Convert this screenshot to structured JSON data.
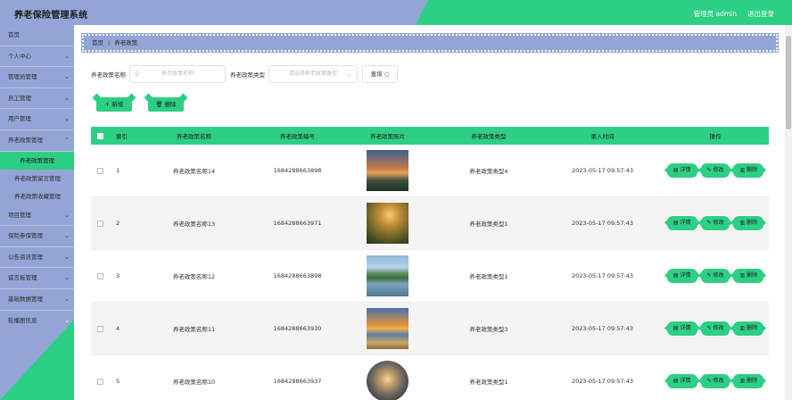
{
  "header": {
    "title": "养老保险管理系统",
    "admin_label": "管理员 admin",
    "logout_label": "退出登录"
  },
  "sidebar": {
    "home": "首页",
    "items": [
      {
        "label": "个人中心"
      },
      {
        "label": "管理员管理"
      },
      {
        "label": "员工管理"
      },
      {
        "label": "用户管理"
      },
      {
        "label": "养老政策管理"
      }
    ],
    "sub_items": [
      {
        "label": "养老政策管理"
      },
      {
        "label": "养老政策留言管理"
      },
      {
        "label": "养老政策收藏管理"
      }
    ],
    "items_after": [
      {
        "label": "项目管理"
      },
      {
        "label": "保险参保管理"
      },
      {
        "label": "公告资讯管理"
      },
      {
        "label": "留言板管理"
      },
      {
        "label": "基础数据管理"
      },
      {
        "label": "轮播图信息"
      }
    ]
  },
  "breadcrumb": {
    "home": "首页",
    "separator": "|",
    "current": "养老政策"
  },
  "search": {
    "name_label": "养老政策名称",
    "name_placeholder": "养老政策名称",
    "type_label": "养老政策类型",
    "type_placeholder": "请选择养老政策类型",
    "query_label": "查询"
  },
  "actions": {
    "add_label": "+ 新增",
    "delete_label": "删除"
  },
  "table": {
    "columns": [
      "索引",
      "养老政策名称",
      "养老政策编号",
      "养老政策照片",
      "养老政策类型",
      "录入时间",
      "操作"
    ],
    "ops": {
      "detail": "详情",
      "edit": "修改",
      "delete": "删除"
    },
    "rows": [
      {
        "index": "1",
        "name": "养老政策名称14",
        "code": "1684288663898",
        "type": "养老政策类型4",
        "time": "2023-05-17 09:57:43"
      },
      {
        "index": "2",
        "name": "养老政策名称13",
        "code": "1684288663971",
        "type": "养老政策类型1",
        "time": "2023-05-17 09:57:43"
      },
      {
        "index": "3",
        "name": "养老政策名称12",
        "code": "1684288663898",
        "type": "养老政策类型1",
        "time": "2023-05-17 09:57:43"
      },
      {
        "index": "4",
        "name": "养老政策名称11",
        "code": "1684288663930",
        "type": "养老政策类型3",
        "time": "2023-05-17 09:57:43"
      },
      {
        "index": "5",
        "name": "养老政策名称10",
        "code": "1684288663937",
        "type": "养老政策类型1",
        "time": "2023-05-17 09:57:43"
      }
    ]
  },
  "colors": {
    "accent_green": "#2dcf85",
    "accent_blue": "#93a5d6"
  }
}
